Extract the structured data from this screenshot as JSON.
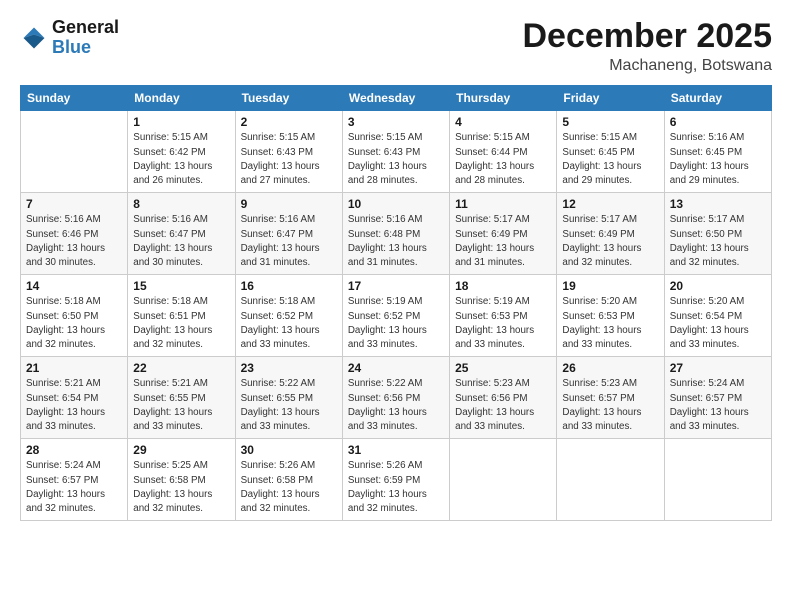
{
  "header": {
    "logo_line1": "General",
    "logo_line2": "Blue",
    "month": "December 2025",
    "location": "Machaneng, Botswana"
  },
  "days_of_week": [
    "Sunday",
    "Monday",
    "Tuesday",
    "Wednesday",
    "Thursday",
    "Friday",
    "Saturday"
  ],
  "weeks": [
    [
      {
        "day": "",
        "info": ""
      },
      {
        "day": "1",
        "info": "Sunrise: 5:15 AM\nSunset: 6:42 PM\nDaylight: 13 hours\nand 26 minutes."
      },
      {
        "day": "2",
        "info": "Sunrise: 5:15 AM\nSunset: 6:43 PM\nDaylight: 13 hours\nand 27 minutes."
      },
      {
        "day": "3",
        "info": "Sunrise: 5:15 AM\nSunset: 6:43 PM\nDaylight: 13 hours\nand 28 minutes."
      },
      {
        "day": "4",
        "info": "Sunrise: 5:15 AM\nSunset: 6:44 PM\nDaylight: 13 hours\nand 28 minutes."
      },
      {
        "day": "5",
        "info": "Sunrise: 5:15 AM\nSunset: 6:45 PM\nDaylight: 13 hours\nand 29 minutes."
      },
      {
        "day": "6",
        "info": "Sunrise: 5:16 AM\nSunset: 6:45 PM\nDaylight: 13 hours\nand 29 minutes."
      }
    ],
    [
      {
        "day": "7",
        "info": "Sunrise: 5:16 AM\nSunset: 6:46 PM\nDaylight: 13 hours\nand 30 minutes."
      },
      {
        "day": "8",
        "info": "Sunrise: 5:16 AM\nSunset: 6:47 PM\nDaylight: 13 hours\nand 30 minutes."
      },
      {
        "day": "9",
        "info": "Sunrise: 5:16 AM\nSunset: 6:47 PM\nDaylight: 13 hours\nand 31 minutes."
      },
      {
        "day": "10",
        "info": "Sunrise: 5:16 AM\nSunset: 6:48 PM\nDaylight: 13 hours\nand 31 minutes."
      },
      {
        "day": "11",
        "info": "Sunrise: 5:17 AM\nSunset: 6:49 PM\nDaylight: 13 hours\nand 31 minutes."
      },
      {
        "day": "12",
        "info": "Sunrise: 5:17 AM\nSunset: 6:49 PM\nDaylight: 13 hours\nand 32 minutes."
      },
      {
        "day": "13",
        "info": "Sunrise: 5:17 AM\nSunset: 6:50 PM\nDaylight: 13 hours\nand 32 minutes."
      }
    ],
    [
      {
        "day": "14",
        "info": "Sunrise: 5:18 AM\nSunset: 6:50 PM\nDaylight: 13 hours\nand 32 minutes."
      },
      {
        "day": "15",
        "info": "Sunrise: 5:18 AM\nSunset: 6:51 PM\nDaylight: 13 hours\nand 32 minutes."
      },
      {
        "day": "16",
        "info": "Sunrise: 5:18 AM\nSunset: 6:52 PM\nDaylight: 13 hours\nand 33 minutes."
      },
      {
        "day": "17",
        "info": "Sunrise: 5:19 AM\nSunset: 6:52 PM\nDaylight: 13 hours\nand 33 minutes."
      },
      {
        "day": "18",
        "info": "Sunrise: 5:19 AM\nSunset: 6:53 PM\nDaylight: 13 hours\nand 33 minutes."
      },
      {
        "day": "19",
        "info": "Sunrise: 5:20 AM\nSunset: 6:53 PM\nDaylight: 13 hours\nand 33 minutes."
      },
      {
        "day": "20",
        "info": "Sunrise: 5:20 AM\nSunset: 6:54 PM\nDaylight: 13 hours\nand 33 minutes."
      }
    ],
    [
      {
        "day": "21",
        "info": "Sunrise: 5:21 AM\nSunset: 6:54 PM\nDaylight: 13 hours\nand 33 minutes."
      },
      {
        "day": "22",
        "info": "Sunrise: 5:21 AM\nSunset: 6:55 PM\nDaylight: 13 hours\nand 33 minutes."
      },
      {
        "day": "23",
        "info": "Sunrise: 5:22 AM\nSunset: 6:55 PM\nDaylight: 13 hours\nand 33 minutes."
      },
      {
        "day": "24",
        "info": "Sunrise: 5:22 AM\nSunset: 6:56 PM\nDaylight: 13 hours\nand 33 minutes."
      },
      {
        "day": "25",
        "info": "Sunrise: 5:23 AM\nSunset: 6:56 PM\nDaylight: 13 hours\nand 33 minutes."
      },
      {
        "day": "26",
        "info": "Sunrise: 5:23 AM\nSunset: 6:57 PM\nDaylight: 13 hours\nand 33 minutes."
      },
      {
        "day": "27",
        "info": "Sunrise: 5:24 AM\nSunset: 6:57 PM\nDaylight: 13 hours\nand 33 minutes."
      }
    ],
    [
      {
        "day": "28",
        "info": "Sunrise: 5:24 AM\nSunset: 6:57 PM\nDaylight: 13 hours\nand 32 minutes."
      },
      {
        "day": "29",
        "info": "Sunrise: 5:25 AM\nSunset: 6:58 PM\nDaylight: 13 hours\nand 32 minutes."
      },
      {
        "day": "30",
        "info": "Sunrise: 5:26 AM\nSunset: 6:58 PM\nDaylight: 13 hours\nand 32 minutes."
      },
      {
        "day": "31",
        "info": "Sunrise: 5:26 AM\nSunset: 6:59 PM\nDaylight: 13 hours\nand 32 minutes."
      },
      {
        "day": "",
        "info": ""
      },
      {
        "day": "",
        "info": ""
      },
      {
        "day": "",
        "info": ""
      }
    ]
  ]
}
